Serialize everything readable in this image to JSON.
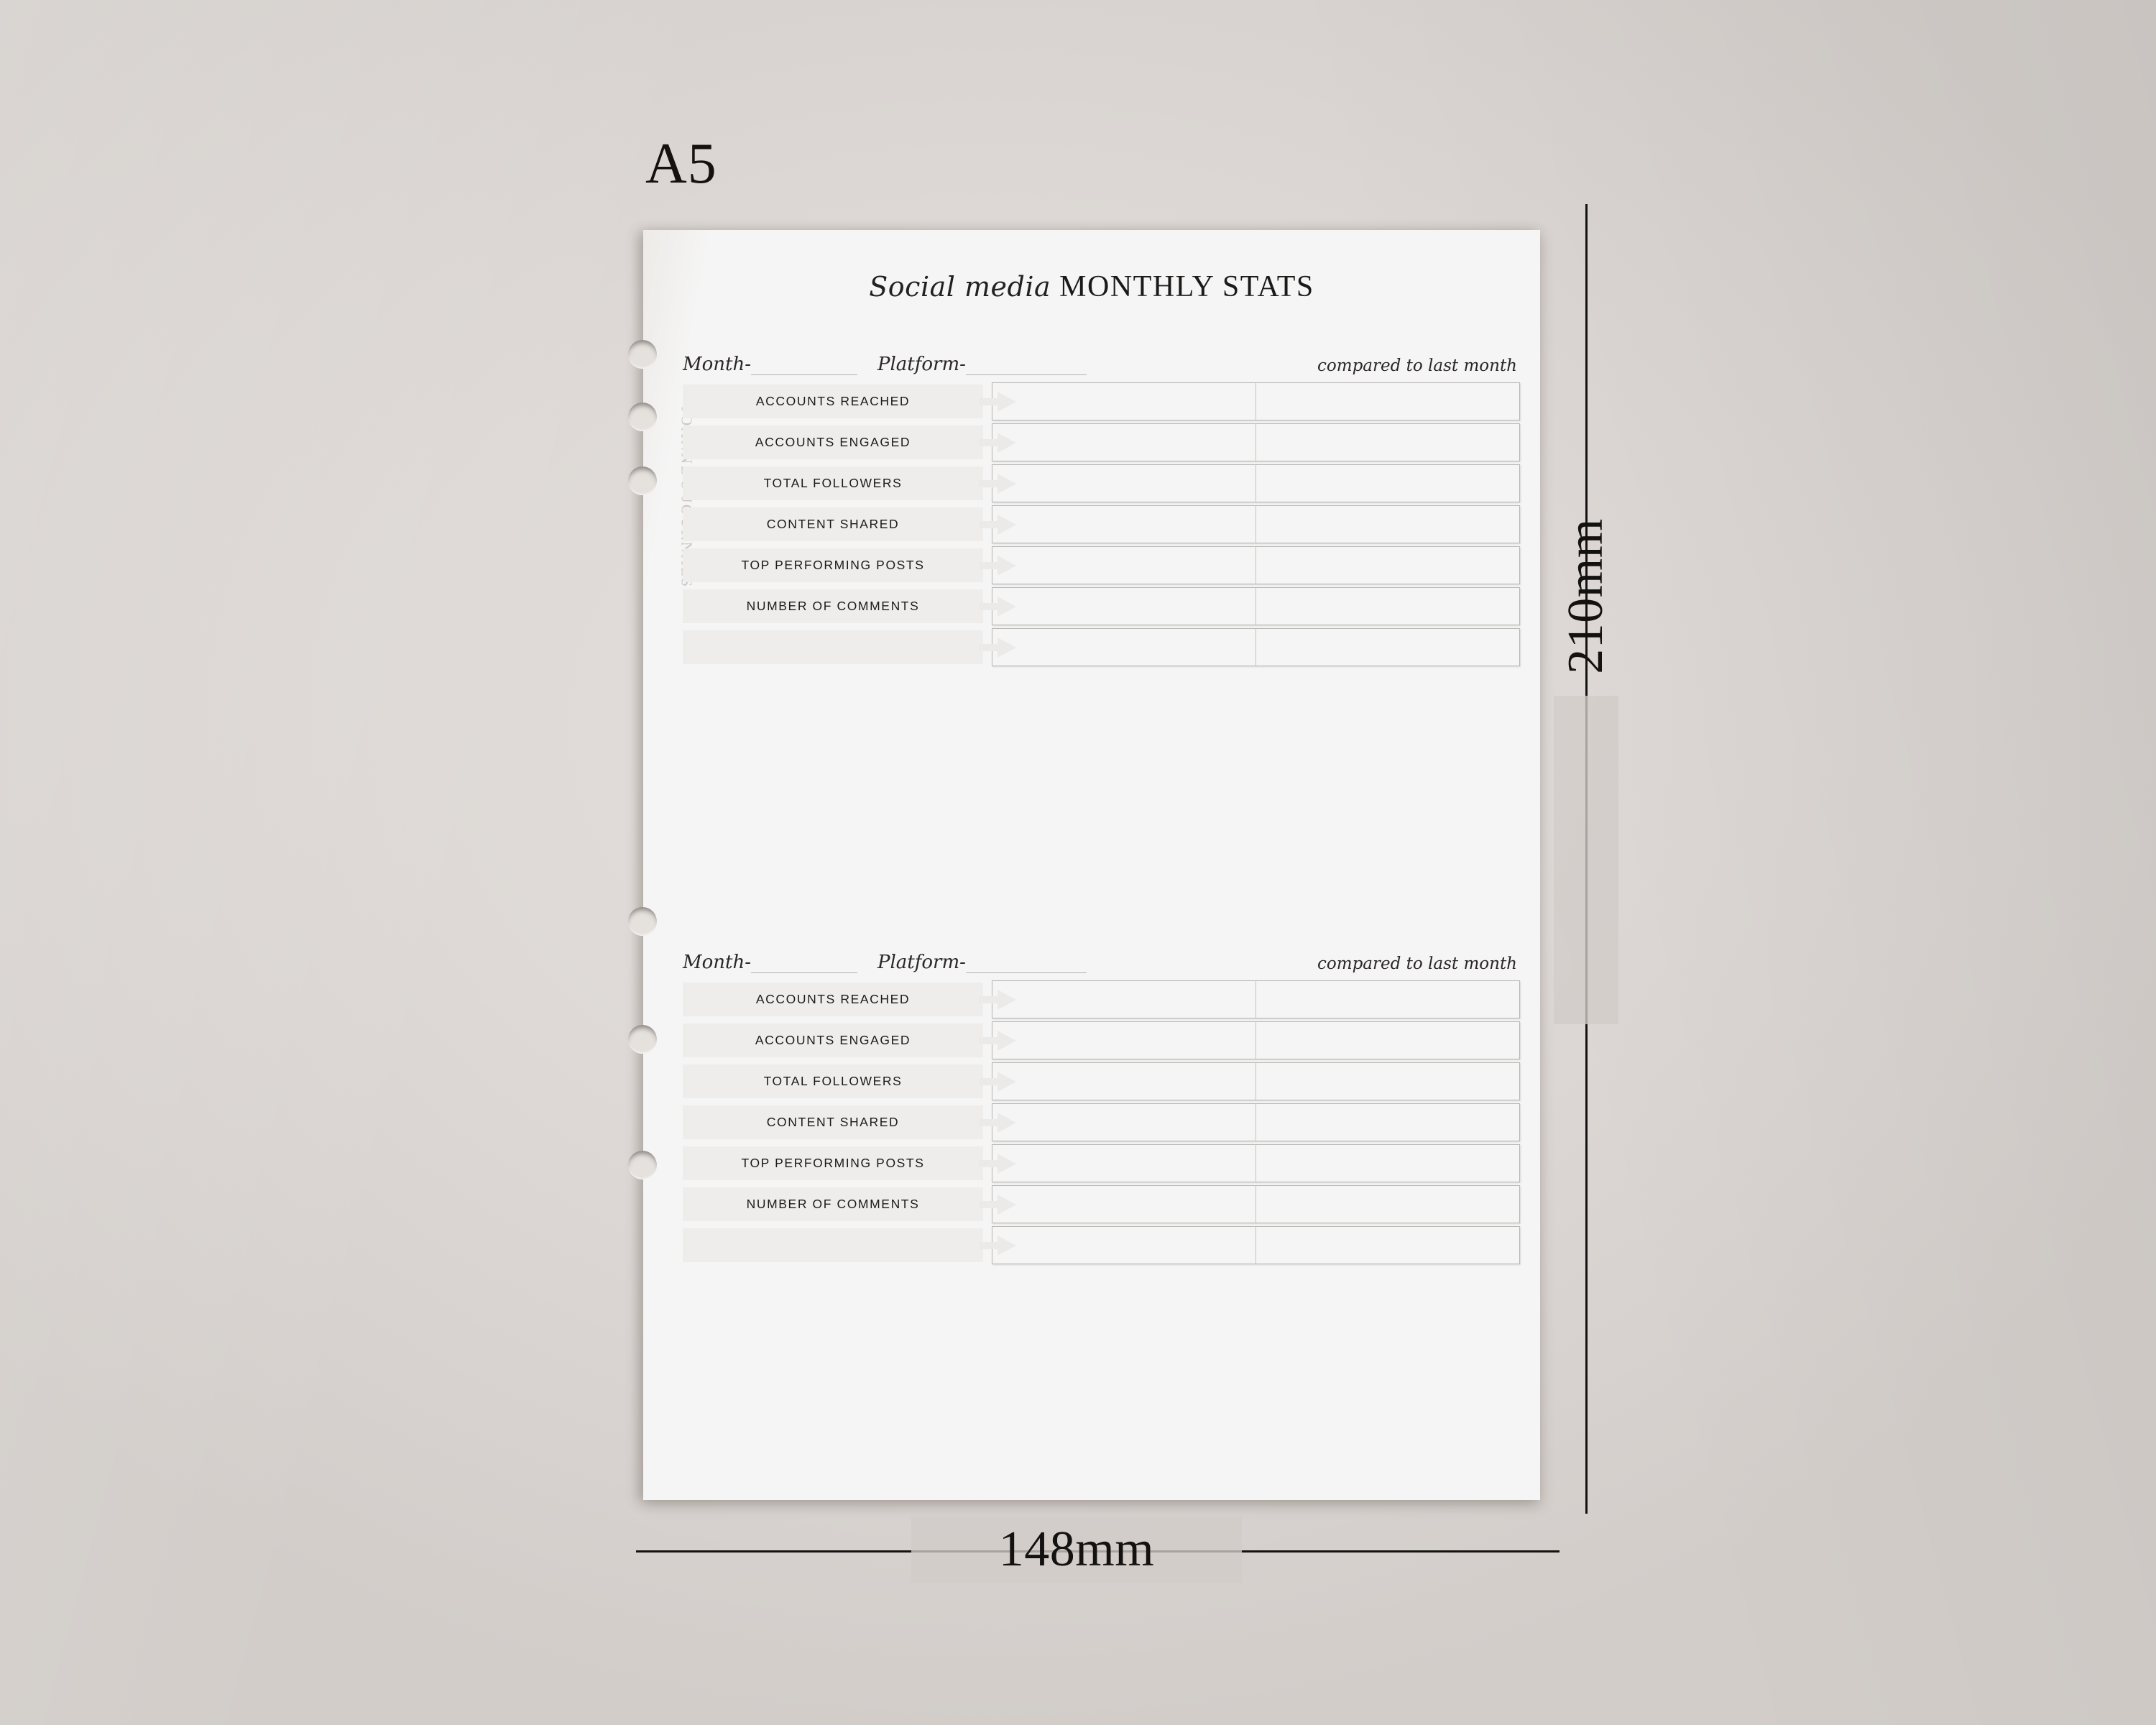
{
  "format_label": "A5",
  "dimensions": {
    "height_label": "210mm",
    "width_label": "148mm"
  },
  "page": {
    "watermark": "JOANNE'S JOURNALS",
    "title": {
      "script_part": "Social media",
      "caps_part": "MONTHLY STATS"
    },
    "fields": {
      "month_label": "Month-",
      "platform_label": "Platform-",
      "compared_label": "compared to last month"
    },
    "row_labels": [
      "ACCOUNTS REACHED",
      "ACCOUNTS ENGAGED",
      "TOTAL FOLLOWERS",
      "CONTENT SHARED",
      "TOP PERFORMING POSTS",
      "NUMBER OF COMMENTS",
      ""
    ],
    "sections": [
      {
        "index": 1
      },
      {
        "index": 2
      }
    ]
  },
  "colors": {
    "canvas": "#dcd8d5",
    "sheet": "#f5f5f5",
    "label_block": "#eeedec",
    "cell_border": "#b9b7b5",
    "ink": "#141210",
    "arrow": "#eceae9",
    "dim_band": "#d1ccc8"
  }
}
